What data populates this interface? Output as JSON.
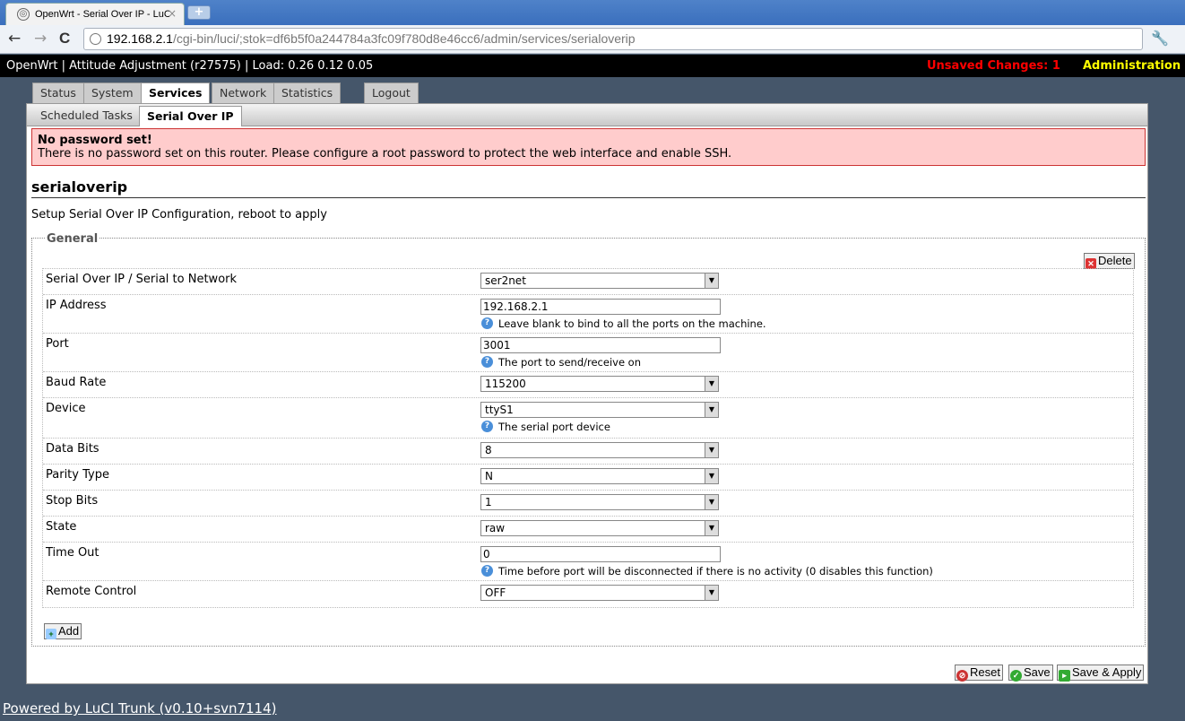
{
  "browser": {
    "tab_title": "OpenWrt - Serial Over IP - LuCI",
    "tab_close": "×",
    "new_tab": "+",
    "url_host": "192.168.2.1",
    "url_path": "/cgi-bin/luci/;stok=df6b5f0a244784a3fc09f780d8e46cc6/admin/services/serialoverip",
    "back": "←",
    "forward": "→",
    "reload": "C",
    "wrench": "🔧"
  },
  "header": {
    "title": "OpenWrt | Attitude Adjustment (r27575) | Load: 0.26 0.12 0.05",
    "unsaved": "Unsaved Changes: 1",
    "admin": "Administration"
  },
  "main_tabs": [
    "Status",
    "System",
    "Services",
    "Network",
    "Statistics",
    "Logout"
  ],
  "sub_tabs": [
    "Scheduled Tasks",
    "Serial Over IP"
  ],
  "alert": {
    "heading": "No password set!",
    "text": "There is no password set on this router. Please configure a root password to protect the web interface and enable SSH."
  },
  "page": {
    "title": "serialoverip",
    "description": "Setup Serial Over IP Configuration, reboot to apply"
  },
  "section": {
    "legend": "General",
    "delete_label": "Delete",
    "add_label": "Add"
  },
  "fields": {
    "mode": {
      "label": "Serial Over IP / Serial to Network",
      "value": "ser2net"
    },
    "ip": {
      "label": "IP Address",
      "value": "192.168.2.1",
      "hint": "Leave blank to bind to all the ports on the machine."
    },
    "port": {
      "label": "Port",
      "value": "3001",
      "hint": "The port to send/receive on"
    },
    "baud": {
      "label": "Baud Rate",
      "value": "115200"
    },
    "device": {
      "label": "Device",
      "value": "ttyS1",
      "hint": "The serial port device"
    },
    "databits": {
      "label": "Data Bits",
      "value": "8"
    },
    "parity": {
      "label": "Parity Type",
      "value": "N"
    },
    "stopbits": {
      "label": "Stop Bits",
      "value": "1"
    },
    "state": {
      "label": "State",
      "value": "raw"
    },
    "timeout": {
      "label": "Time Out",
      "value": "0",
      "hint": "Time before port will be disconnected if there is no activity (0 disables this function)"
    },
    "remote": {
      "label": "Remote Control",
      "value": "OFF"
    }
  },
  "actions": {
    "reset": "Reset",
    "save": "Save",
    "save_apply": "Save & Apply"
  },
  "footer": "Powered by LuCI Trunk (v0.10+svn7114)",
  "colors": {
    "alert_bg": "#ffcccc",
    "unsaved": "#ff0000",
    "admin": "#ffff00",
    "page_bg": "#45566a"
  }
}
